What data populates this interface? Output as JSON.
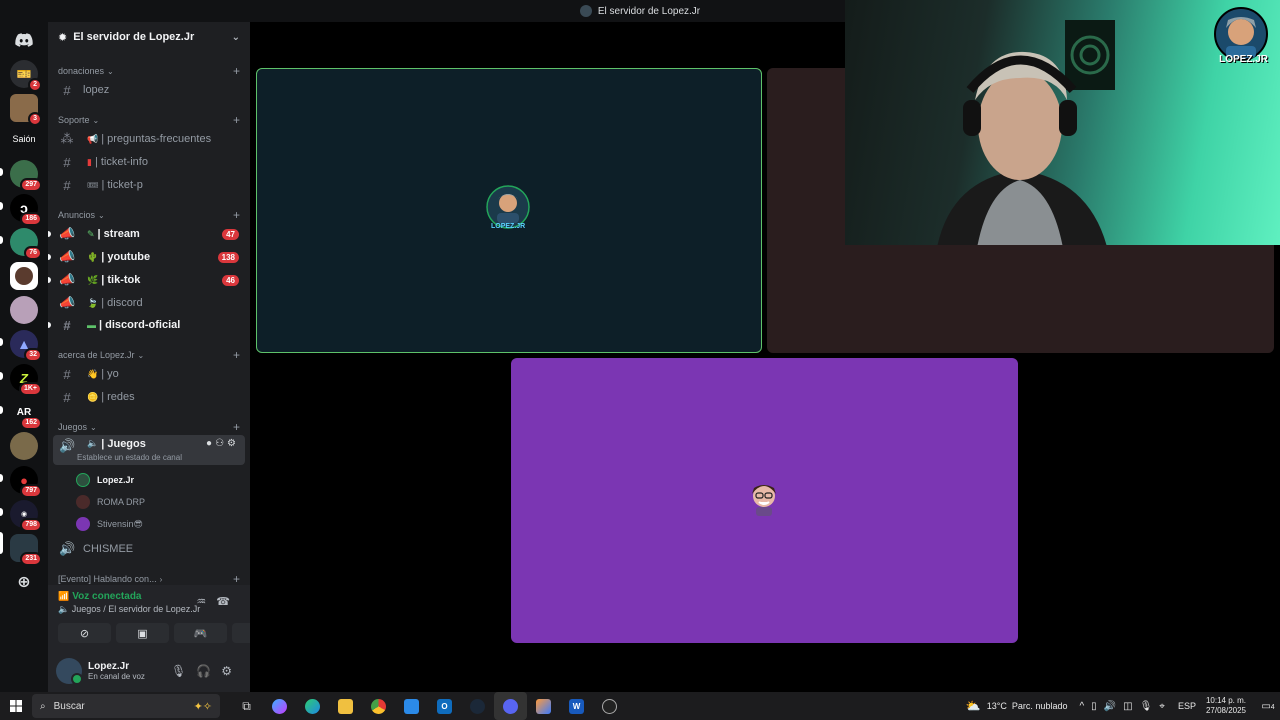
{
  "window": {
    "title": "El servidor de Lopez.Jr"
  },
  "rail": {
    "saion_label": "Saión",
    "badges": [
      "2",
      "3",
      "297",
      "186",
      "76",
      "32",
      "1K+",
      "162",
      "797",
      "798",
      "231"
    ],
    "ar_text": "AR"
  },
  "server": {
    "name": "El servidor de Lopez.Jr"
  },
  "categories": {
    "donaciones": "donaciones",
    "soporte": "Soporte",
    "anuncios": "Anuncios",
    "acerca": "acerca de Lopez.Jr",
    "juegos": "Juegos",
    "evento": "[Evento] Hablando con..."
  },
  "channels": {
    "lopez": "lopez",
    "preguntas": "| preguntas-frecuentes",
    "ticket_info": "| ticket-info",
    "ticket_p": "| ticket-p",
    "stream": "| stream",
    "stream_badge": "47",
    "youtube": "| youtube",
    "youtube_badge": "138",
    "tiktok": "| tik-tok",
    "tiktok_badge": "46",
    "discord": "| discord",
    "discord_oficial": "| discord-oficial",
    "yo": "| yo",
    "redes": "| redes",
    "juegos": "| Juegos",
    "juegos_status": "Establece un estado de canal",
    "chismee": "CHISMEE"
  },
  "voice_users": [
    "Lopez.Jr",
    "ROMA DRP",
    "Stivensin😎"
  ],
  "voice_panel": {
    "status": "Voz conectada",
    "location": "Juegos / El servidor de Lopez.Jr"
  },
  "user": {
    "name": "Lopez.Jr",
    "status": "En canal de voz"
  },
  "tiles": {
    "logo_text": "LOPEZ.JR"
  },
  "webcam": {
    "logo_text": "LOPEZ.JR"
  },
  "taskbar": {
    "search_placeholder": "Buscar",
    "word_letter": "W",
    "weather_temp": "13°C",
    "weather_desc": "Parc. nublado",
    "lang": "ESP",
    "time": "10:14 p. m.",
    "date": "27/08/2025",
    "notifications": "4"
  },
  "colors": {
    "accent_green": "#23a55a",
    "badge_red": "#da373c",
    "tile_purple": "#7b36b3",
    "tile_teal": "#0d1f28"
  }
}
